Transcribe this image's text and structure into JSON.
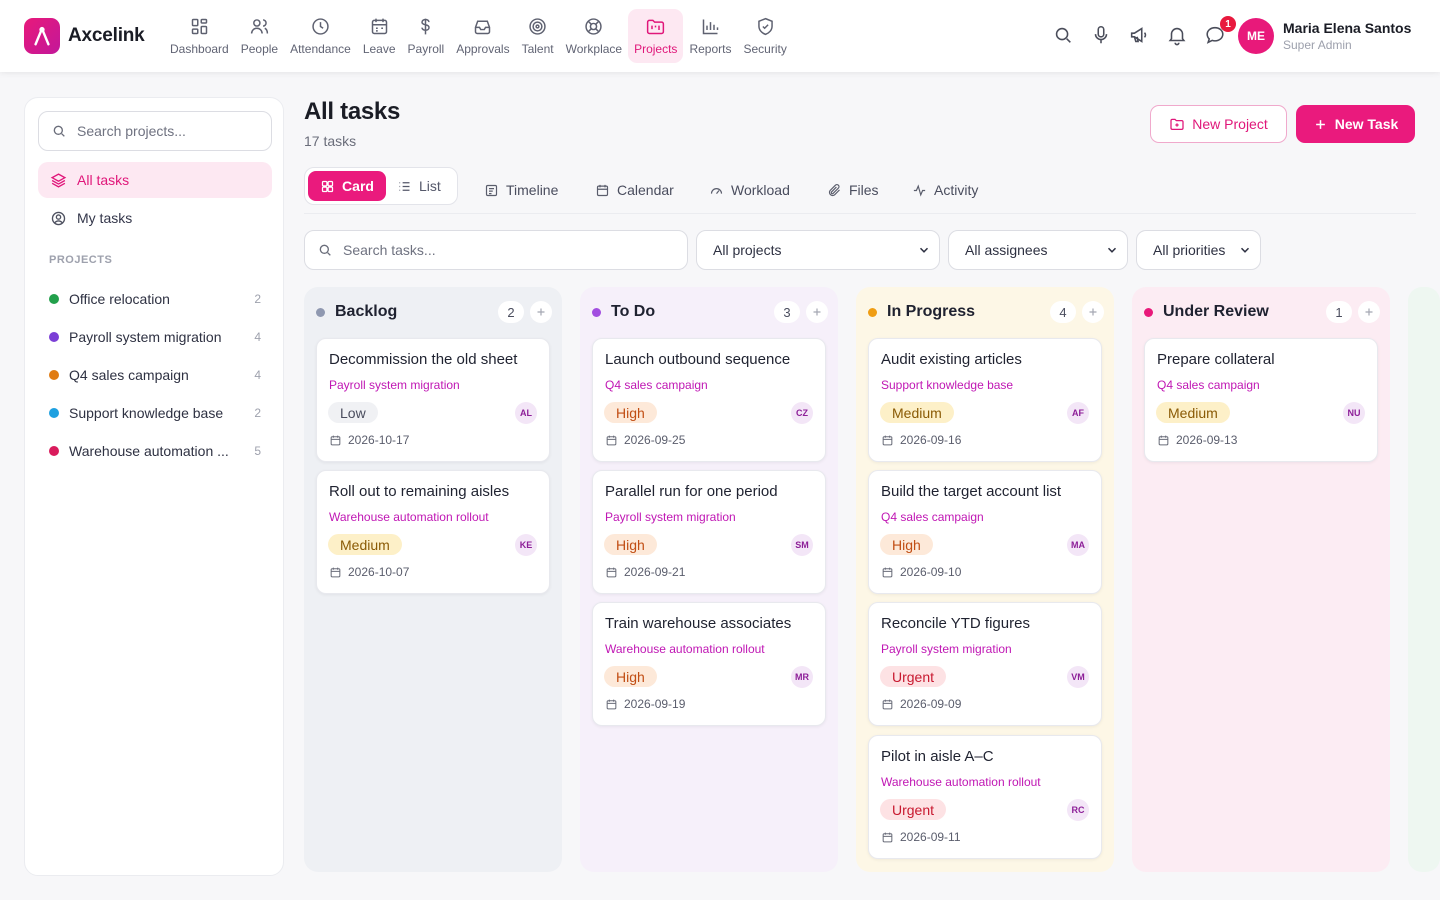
{
  "app": {
    "name": "Axcelink",
    "brand_color": "#e8197a"
  },
  "nav": [
    {
      "label": "Dashboard",
      "icon": "grid-icon"
    },
    {
      "label": "People",
      "icon": "users-icon"
    },
    {
      "label": "Attendance",
      "icon": "clock-icon"
    },
    {
      "label": "Leave",
      "icon": "calendar-icon"
    },
    {
      "label": "Payroll",
      "icon": "dollar-icon"
    },
    {
      "label": "Approvals",
      "icon": "inbox-icon"
    },
    {
      "label": "Talent",
      "icon": "target-icon"
    },
    {
      "label": "Workplace",
      "icon": "lifebuoy-icon"
    },
    {
      "label": "Projects",
      "icon": "folder-kanban-icon",
      "active": true
    },
    {
      "label": "Reports",
      "icon": "bar-chart-icon"
    },
    {
      "label": "Security",
      "icon": "shield-icon"
    }
  ],
  "topbar": {
    "notifications_count": "1"
  },
  "user": {
    "initials": "ME",
    "name": "Maria Elena Santos",
    "role": "Super Admin"
  },
  "sidebar": {
    "search_placeholder": "Search projects...",
    "all_tasks": "All tasks",
    "my_tasks": "My tasks",
    "projects_heading": "PROJECTS",
    "projects": [
      {
        "name": "Office relocation",
        "count": "2",
        "color": "#22a04b"
      },
      {
        "name": "Payroll system migration",
        "count": "4",
        "color": "#7b3fd6"
      },
      {
        "name": "Q4 sales campaign",
        "count": "4",
        "color": "#e07b12"
      },
      {
        "name": "Support knowledge base",
        "count": "2",
        "color": "#1ea0e0"
      },
      {
        "name": "Warehouse automation ...",
        "count": "5",
        "color": "#d91b5c"
      }
    ]
  },
  "main": {
    "title": "All tasks",
    "subtitle": "17 tasks",
    "new_project": "New Project",
    "new_task": "New Task",
    "view_card": "Card",
    "view_list": "List",
    "tabs": [
      "Timeline",
      "Calendar",
      "Workload",
      "Files",
      "Activity"
    ],
    "search_placeholder": "Search tasks...",
    "filters": {
      "project": "All projects",
      "assignee": "All assignees",
      "priority": "All priorities"
    }
  },
  "board": {
    "columns": [
      {
        "title": "Backlog",
        "count": "2",
        "color": "#8f98b0",
        "bg": "#eef0f4",
        "cards": [
          {
            "title": "Decommission the old sheet",
            "project": "Payroll system migration",
            "priority": "Low",
            "assignee": "AL",
            "due": "2026-10-17"
          },
          {
            "title": "Roll out to remaining aisles",
            "project": "Warehouse automation rollout",
            "priority": "Medium",
            "assignee": "KE",
            "due": "2026-10-07"
          }
        ]
      },
      {
        "title": "To Do",
        "count": "3",
        "color": "#a24ee0",
        "bg": "#f6f0fa",
        "cards": [
          {
            "title": "Launch outbound sequence",
            "project": "Q4 sales campaign",
            "priority": "High",
            "assignee": "CZ",
            "due": "2026-09-25"
          },
          {
            "title": "Parallel run for one period",
            "project": "Payroll system migration",
            "priority": "High",
            "assignee": "SM",
            "due": "2026-09-21"
          },
          {
            "title": "Train warehouse associates",
            "project": "Warehouse automation rollout",
            "priority": "High",
            "assignee": "MR",
            "due": "2026-09-19"
          }
        ]
      },
      {
        "title": "In Progress",
        "count": "4",
        "color": "#ef9d13",
        "bg": "#fdf7e6",
        "cards": [
          {
            "title": "Audit existing articles",
            "project": "Support knowledge base",
            "priority": "Medium",
            "assignee": "AF",
            "due": "2026-09-16"
          },
          {
            "title": "Build the target account list",
            "project": "Q4 sales campaign",
            "priority": "High",
            "assignee": "MA",
            "due": "2026-09-10"
          },
          {
            "title": "Reconcile YTD figures",
            "project": "Payroll system migration",
            "priority": "Urgent",
            "assignee": "VM",
            "due": "2026-09-09"
          },
          {
            "title": "Pilot in aisle A–C",
            "project": "Warehouse automation rollout",
            "priority": "Urgent",
            "assignee": "RC",
            "due": "2026-09-11"
          }
        ]
      },
      {
        "title": "Under Review",
        "count": "1",
        "color": "#e8197a",
        "bg": "#fcecf3",
        "cards": [
          {
            "title": "Prepare collateral",
            "project": "Q4 sales campaign",
            "priority": "Medium",
            "assignee": "NU",
            "due": "2026-09-13"
          }
        ]
      }
    ]
  }
}
